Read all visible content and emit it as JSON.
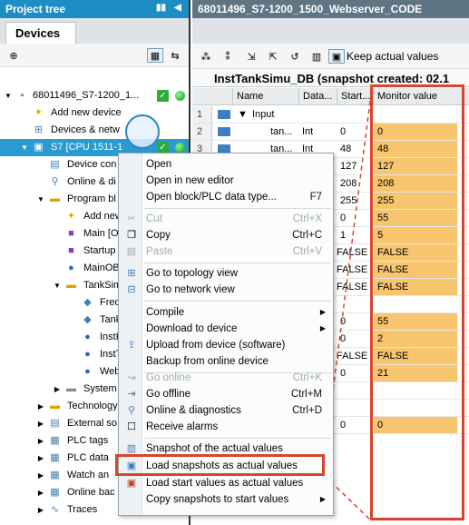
{
  "left": {
    "header": "Project tree",
    "tab": "Devices",
    "tree": [
      {
        "label": "68011496_S7-1200_1..."
      },
      {
        "label": "Add new device"
      },
      {
        "label": "Devices & netw"
      },
      {
        "label": "S7 [CPU 1511-1"
      },
      {
        "label": "Device con"
      },
      {
        "label": "Online & di"
      },
      {
        "label": "Program bl"
      },
      {
        "label": "Add new"
      },
      {
        "label": "Main [O"
      },
      {
        "label": "Startup"
      },
      {
        "label": "MainOB"
      },
      {
        "label": "TankSim"
      },
      {
        "label": "Freq"
      },
      {
        "label": "Tank"
      },
      {
        "label": "InstF"
      },
      {
        "label": "InstT"
      },
      {
        "label": "Web."
      },
      {
        "label": "System"
      },
      {
        "label": "Technology"
      },
      {
        "label": "External so"
      },
      {
        "label": "PLC tags"
      },
      {
        "label": "PLC data"
      },
      {
        "label": "Watch an"
      },
      {
        "label": "Online bac"
      },
      {
        "label": "Traces"
      }
    ]
  },
  "editor": {
    "header": "68011496_S7-1200_1500_Webserver_CODE",
    "toolbar_label": "Keep actual values",
    "title": "InstTankSimu_DB (snapshot created: 02.1",
    "columns": {
      "name": "Name",
      "datatype": "Data...",
      "start": "Start...",
      "monitor": "Monitor value"
    },
    "rows": [
      {
        "num": "1",
        "name": "Input",
        "type": "",
        "start": "",
        "monitor": ""
      },
      {
        "num": "2",
        "name": "tan...",
        "type": "Int",
        "start": "0",
        "monitor": "0"
      },
      {
        "num": "3",
        "name": "tan...",
        "type": "Int",
        "start": "48",
        "monitor": "48"
      },
      {
        "num": "",
        "name": "",
        "type": "",
        "start": "127",
        "monitor": "127"
      },
      {
        "num": "",
        "name": "",
        "type": "",
        "start": "208",
        "monitor": "208"
      },
      {
        "num": "",
        "name": "",
        "type": "",
        "start": "255",
        "monitor": "255"
      },
      {
        "num": "",
        "name": "",
        "type": "",
        "start": "0",
        "monitor": "55"
      },
      {
        "num": "",
        "name": "",
        "type": "",
        "start": "1",
        "monitor": "5"
      },
      {
        "num": "",
        "name": "",
        "type": "",
        "start": "FALSE",
        "monitor": "FALSE"
      },
      {
        "num": "",
        "name": "",
        "type": "",
        "start": "FALSE",
        "monitor": "FALSE"
      },
      {
        "num": "",
        "name": "",
        "type": "",
        "start": "FALSE",
        "monitor": "FALSE"
      },
      {
        "num": "",
        "name": "",
        "type": "",
        "start": "",
        "monitor": ""
      },
      {
        "num": "",
        "name": "",
        "type": "",
        "start": "0",
        "monitor": "55"
      },
      {
        "num": "",
        "name": "",
        "type": "",
        "start": "0",
        "monitor": "2"
      },
      {
        "num": "",
        "name": "",
        "type": "",
        "start": "FALSE",
        "monitor": "FALSE"
      },
      {
        "num": "",
        "name": "",
        "type": "",
        "start": "0",
        "monitor": "21"
      },
      {
        "num": "",
        "name": "",
        "type": "",
        "start": "",
        "monitor": ""
      },
      {
        "num": "",
        "name": "",
        "type": "",
        "start": "",
        "monitor": ""
      },
      {
        "num": "",
        "name": "",
        "type": "",
        "start": "0",
        "monitor": "0"
      }
    ]
  },
  "menu": {
    "items": [
      {
        "label": "Open",
        "shortcut": "",
        "icon": "",
        "disabled": false,
        "submenu": false
      },
      {
        "label": "Open in new editor",
        "shortcut": "",
        "icon": "",
        "disabled": false,
        "submenu": false
      },
      {
        "label": "Open block/PLC data type...",
        "shortcut": "F7",
        "icon": "",
        "disabled": false,
        "submenu": false
      },
      {
        "label": "Cut",
        "shortcut": "Ctrl+X",
        "icon": "scissors-icon",
        "disabled": true,
        "submenu": false
      },
      {
        "label": "Copy",
        "shortcut": "Ctrl+C",
        "icon": "copy-icon",
        "disabled": false,
        "submenu": false
      },
      {
        "label": "Paste",
        "shortcut": "Ctrl+V",
        "icon": "paste-icon",
        "disabled": true,
        "submenu": false
      },
      {
        "label": "Go to topology view",
        "shortcut": "",
        "icon": "topology-icon",
        "disabled": false,
        "submenu": false
      },
      {
        "label": "Go to network view",
        "shortcut": "",
        "icon": "network-icon",
        "disabled": false,
        "submenu": false
      },
      {
        "label": "Compile",
        "shortcut": "",
        "icon": "",
        "disabled": false,
        "submenu": true
      },
      {
        "label": "Download to device",
        "shortcut": "",
        "icon": "",
        "disabled": false,
        "submenu": true
      },
      {
        "label": "Upload from device (software)",
        "shortcut": "",
        "icon": "upload-icon",
        "disabled": false,
        "submenu": false
      },
      {
        "label": "Backup from online device",
        "shortcut": "",
        "icon": "",
        "disabled": false,
        "submenu": false
      },
      {
        "label": "Go online",
        "shortcut": "Ctrl+K",
        "icon": "go-online-icon",
        "disabled": true,
        "submenu": false
      },
      {
        "label": "Go offline",
        "shortcut": "Ctrl+M",
        "icon": "go-offline-icon",
        "disabled": false,
        "submenu": false
      },
      {
        "label": "Online & diagnostics",
        "shortcut": "Ctrl+D",
        "icon": "diagnostics-icon",
        "disabled": false,
        "submenu": false
      },
      {
        "label": "Receive alarms",
        "shortcut": "",
        "icon": "checkbox-icon",
        "disabled": false,
        "submenu": false
      },
      {
        "label": "Snapshot of the actual values",
        "shortcut": "",
        "icon": "snapshot-icon",
        "disabled": false,
        "submenu": false
      },
      {
        "label": "Load snapshots as actual values",
        "shortcut": "",
        "icon": "load-snapshot-icon",
        "disabled": false,
        "submenu": false
      },
      {
        "label": "Load start values as actual values",
        "shortcut": "",
        "icon": "load-start-icon",
        "disabled": false,
        "submenu": false
      },
      {
        "label": "Copy snapshots to start values",
        "shortcut": "",
        "icon": "",
        "disabled": false,
        "submenu": true
      }
    ]
  },
  "colors": {
    "accent": "#1f8dc5",
    "highlight_callout": "#d8442d",
    "monitor_fill": "#f7c56e",
    "status_green": "#2eab3f"
  }
}
